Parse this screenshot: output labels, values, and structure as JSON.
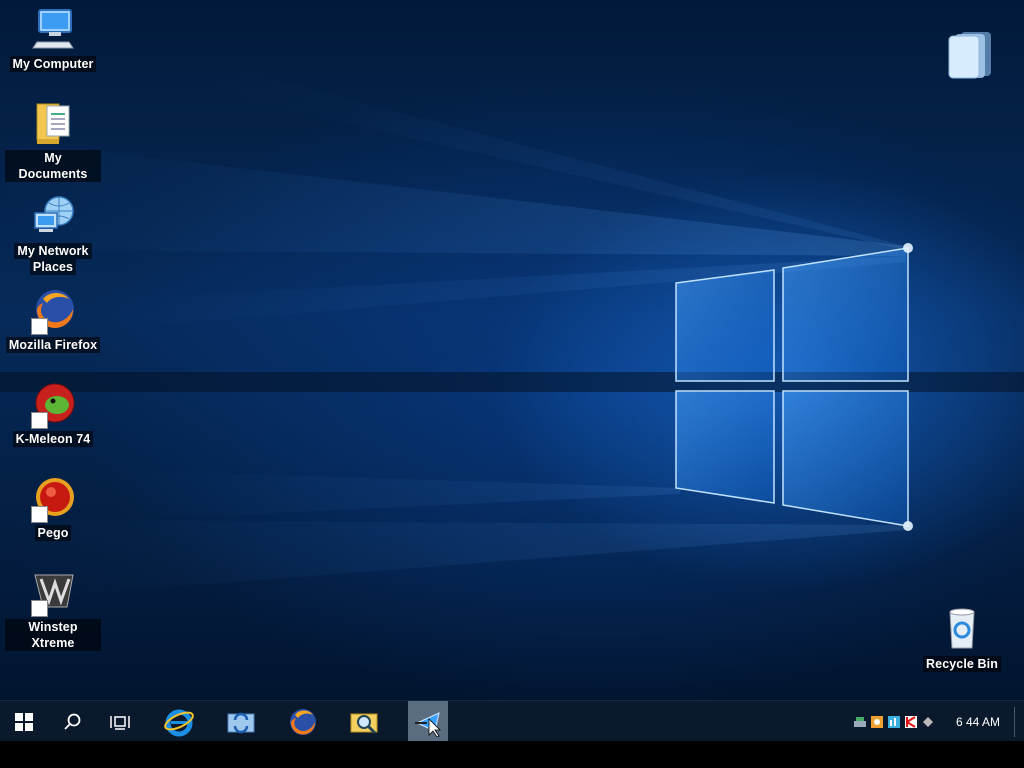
{
  "desktop": {
    "icons": [
      {
        "label_line1": "My Computer",
        "label_line2": ""
      },
      {
        "label_line1": "My Documents",
        "label_line2": ""
      },
      {
        "label_line1": "My Network",
        "label_line2": "Places"
      },
      {
        "label_line1": "Mozilla Firefox",
        "label_line2": ""
      },
      {
        "label_line1": "K-Meleon 74",
        "label_line2": ""
      },
      {
        "label_line1": "Pego",
        "label_line2": ""
      },
      {
        "label_line1": "Winstep Xtreme",
        "label_line2": ""
      }
    ],
    "recycle_bin": {
      "label": "Recycle Bin"
    },
    "top_right_widget": {
      "icon": "stack-icon"
    }
  },
  "taskbar": {
    "start_icon": "windows-logo-icon",
    "search_icon": "search-icon",
    "task_view_icon": "task-view-icon",
    "pinned": [
      {
        "icon": "internet-explorer-icon"
      },
      {
        "icon": "sync-folder-icon"
      },
      {
        "icon": "firefox-icon"
      },
      {
        "icon": "magnifier-folder-icon"
      },
      {
        "icon": "send-arrow-icon",
        "active": true
      }
    ],
    "tray_icons": [
      "network-icon",
      "media-icon",
      "monitor-icon",
      "antivirus-icon",
      "usb-icon"
    ],
    "clock": "6 44 AM"
  },
  "colors": {
    "taskbar": "#0a1a2c",
    "accent": "#1e78e6",
    "active_button": "#5a6c80"
  }
}
